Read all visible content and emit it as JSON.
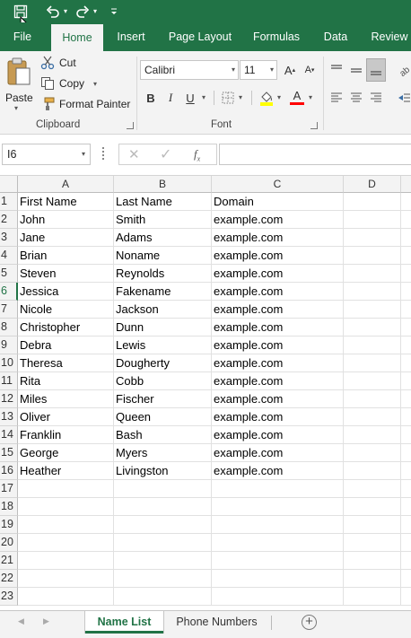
{
  "ribbon_tabs": [
    {
      "label": "File"
    },
    {
      "label": "Home"
    },
    {
      "label": "Insert"
    },
    {
      "label": "Page Layout"
    },
    {
      "label": "Formulas"
    },
    {
      "label": "Data"
    },
    {
      "label": "Review"
    }
  ],
  "clipboard": {
    "paste_label": "Paste",
    "cut_label": "Cut",
    "copy_label": "Copy",
    "format_painter_label": "Format Painter",
    "group_label": "Clipboard"
  },
  "font": {
    "font_name": "Calibri",
    "font_size": "11",
    "bold": "B",
    "italic": "I",
    "underline": "U",
    "font_color_glyph": "A",
    "group_label": "Font"
  },
  "formula_bar": {
    "name_box": "I6",
    "formula": ""
  },
  "columns": [
    "A",
    "B",
    "C",
    "D"
  ],
  "rows": [
    {
      "num": "1",
      "cells": [
        "First Name",
        "Last Name",
        "Domain",
        ""
      ]
    },
    {
      "num": "2",
      "cells": [
        "John",
        "Smith",
        "example.com",
        ""
      ]
    },
    {
      "num": "3",
      "cells": [
        "Jane",
        "Adams",
        "example.com",
        ""
      ]
    },
    {
      "num": "4",
      "cells": [
        "Brian",
        "Noname",
        "example.com",
        ""
      ]
    },
    {
      "num": "5",
      "cells": [
        "Steven",
        "Reynolds",
        "example.com",
        ""
      ]
    },
    {
      "num": "6",
      "cells": [
        "Jessica",
        "Fakename",
        "example.com",
        ""
      ]
    },
    {
      "num": "7",
      "cells": [
        "Nicole",
        "Jackson",
        "example.com",
        ""
      ]
    },
    {
      "num": "8",
      "cells": [
        "Christopher",
        "Dunn",
        "example.com",
        ""
      ]
    },
    {
      "num": "9",
      "cells": [
        "Debra",
        "Lewis",
        "example.com",
        ""
      ]
    },
    {
      "num": "10",
      "cells": [
        "Theresa",
        "Dougherty",
        "example.com",
        ""
      ]
    },
    {
      "num": "11",
      "cells": [
        "Rita",
        "Cobb",
        "example.com",
        ""
      ]
    },
    {
      "num": "12",
      "cells": [
        "Miles",
        "Fischer",
        "example.com",
        ""
      ]
    },
    {
      "num": "13",
      "cells": [
        "Oliver",
        "Queen",
        "example.com",
        ""
      ]
    },
    {
      "num": "14",
      "cells": [
        "Franklin",
        "Bash",
        "example.com",
        ""
      ]
    },
    {
      "num": "15",
      "cells": [
        "George",
        "Myers",
        "example.com",
        ""
      ]
    },
    {
      "num": "16",
      "cells": [
        "Heather",
        "Livingston",
        "example.com",
        ""
      ]
    },
    {
      "num": "17",
      "cells": [
        "",
        "",
        "",
        ""
      ]
    },
    {
      "num": "18",
      "cells": [
        "",
        "",
        "",
        ""
      ]
    },
    {
      "num": "19",
      "cells": [
        "",
        "",
        "",
        ""
      ]
    },
    {
      "num": "20",
      "cells": [
        "",
        "",
        "",
        ""
      ]
    },
    {
      "num": "21",
      "cells": [
        "",
        "",
        "",
        ""
      ]
    },
    {
      "num": "22",
      "cells": [
        "",
        "",
        "",
        ""
      ]
    },
    {
      "num": "23",
      "cells": [
        "",
        "",
        "",
        ""
      ]
    }
  ],
  "selected_row": "6",
  "sheet_tabs": [
    {
      "label": "Name List",
      "active": true
    },
    {
      "label": "Phone Numbers",
      "active": false
    }
  ],
  "colors": {
    "accent": "#217346",
    "ribbon_bg": "#f3f3f3",
    "highlight_yellow": "#ffff00",
    "font_red": "#ff0000"
  },
  "icons": [
    "save-icon",
    "undo-icon",
    "redo-icon",
    "customize-qat-icon",
    "paste-icon",
    "cut-icon",
    "copy-icon",
    "format-painter-icon",
    "increase-font-icon",
    "decrease-font-icon",
    "borders-icon",
    "fill-color-icon",
    "font-color-icon",
    "align-top-icon",
    "align-middle-icon",
    "align-bottom-icon",
    "align-left-icon",
    "align-center-icon",
    "align-right-icon",
    "orientation-icon",
    "indent-icon",
    "cancel-icon",
    "enter-icon",
    "function-icon",
    "add-sheet-icon"
  ]
}
